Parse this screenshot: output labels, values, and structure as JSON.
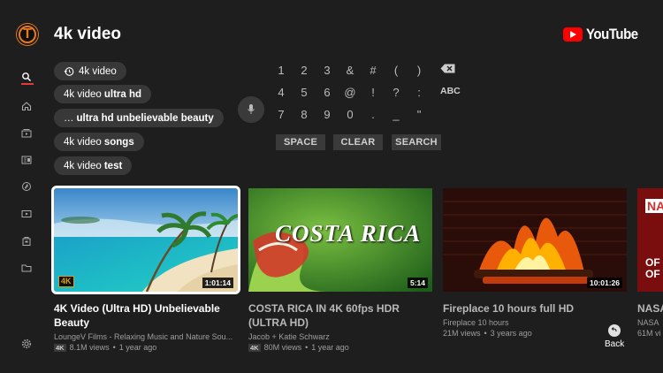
{
  "header": {
    "search_query": "4k video",
    "logo_text": "YouTube",
    "avatar_letter": "T"
  },
  "suggestions": [
    {
      "prefix": "4k video",
      "bold": "",
      "history": true
    },
    {
      "prefix": "4k video",
      "bold": "ultra hd",
      "history": false
    },
    {
      "prefix": "…",
      "bold": "ultra hd unbelievable beauty",
      "history": false
    },
    {
      "prefix": "4k video",
      "bold": "songs",
      "history": false
    },
    {
      "prefix": "4k video",
      "bold": "test",
      "history": false
    }
  ],
  "keyboard": {
    "rows": [
      [
        "1",
        "2",
        "3",
        "&",
        "#",
        "(",
        ")"
      ],
      [
        "4",
        "5",
        "6",
        "@",
        "!",
        "?",
        ":"
      ],
      [
        "7",
        "8",
        "9",
        "0",
        ".",
        "_",
        "\""
      ]
    ],
    "abc_label": "ABC",
    "space_label": "SPACE",
    "clear_label": "CLEAR",
    "search_label": "SEARCH"
  },
  "videos": [
    {
      "title": "4K Video (Ultra HD) Unbelievable Beauty",
      "channel": "LoungeV Films - Relaxing Music and Nature Sou...",
      "badge": "4K",
      "views": "8.1M views",
      "age": "1 year ago",
      "duration": "1:01:14"
    },
    {
      "title": "COSTA RICA IN 4K 60fps HDR (ULTRA HD)",
      "channel": "Jacob + Katie Schwarz",
      "badge": "4K",
      "views": "80M views",
      "age": "1 year ago",
      "duration": "5:14",
      "thumb_text": "COSTA RICA"
    },
    {
      "title": "Fireplace 10 hours full HD",
      "channel": "Fireplace 10 hours",
      "badge": "",
      "views": "21M views",
      "age": "3 years ago",
      "duration": "10:01:26"
    },
    {
      "title": "NASA NASA",
      "channel": "NASA",
      "badge": "",
      "views": "61M vi",
      "age": "",
      "duration": "",
      "thumb_text": "NA"
    }
  ],
  "back_label": "Back",
  "colors": {
    "accent": "#e53935",
    "youtube_red": "#ff0000",
    "background": "#1e1e1e"
  }
}
